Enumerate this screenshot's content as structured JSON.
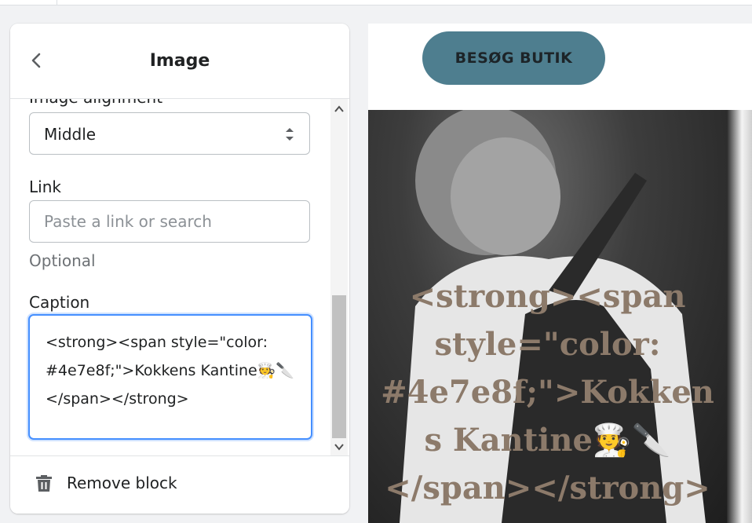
{
  "panel": {
    "title": "Image",
    "fields": {
      "image_alignment": {
        "label": "Image alignment",
        "value": "Middle"
      },
      "link": {
        "label": "Link",
        "placeholder": "Paste a link or search",
        "help": "Optional",
        "value": ""
      },
      "caption": {
        "label": "Caption",
        "value": "<strong><span style=\"color: #4e7e8f;\">Kokkens Kantine🧑‍🍳🔪</span></strong>"
      }
    },
    "footer": {
      "remove_label": "Remove block"
    }
  },
  "preview": {
    "shop_button_label": "BESØG BUTIK",
    "caption_text": "<strong><span style=\"color: #4e7e8f;\">Kokkens Kantine🧑‍🍳🔪</span></strong>"
  },
  "colors": {
    "accent": "#4e7e8f",
    "focus": "#458fff",
    "caption_text": "#8c7a6a"
  },
  "icons": {
    "back": "chevron-left-icon",
    "select": "select-arrows-icon",
    "scroll_up": "chevron-up-icon",
    "scroll_down": "chevron-down-icon",
    "remove": "trash-icon"
  }
}
